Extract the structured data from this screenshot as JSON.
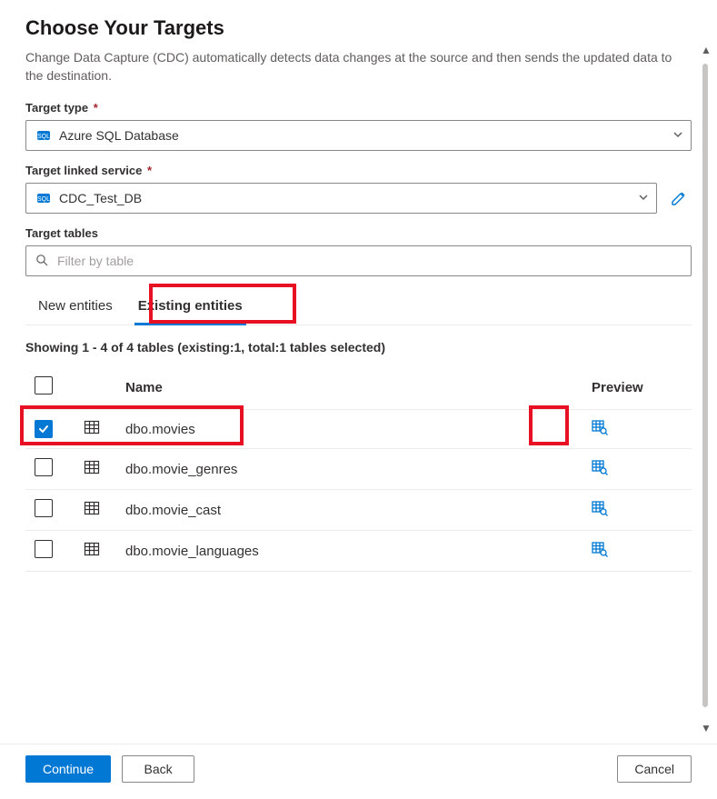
{
  "title": "Choose Your Targets",
  "description": "Change Data Capture (CDC) automatically detects data changes at the source and then sends the updated data to the destination.",
  "target_type": {
    "label": "Target type",
    "required_marker": "*",
    "value": "Azure SQL Database"
  },
  "linked_service": {
    "label": "Target linked service",
    "required_marker": "*",
    "value": "CDC_Test_DB"
  },
  "target_tables": {
    "label": "Target tables",
    "filter_placeholder": "Filter by table"
  },
  "tabs": {
    "new": "New entities",
    "existing": "Existing entities",
    "active": "existing"
  },
  "status_line": "Showing 1 - 4 of 4 tables (existing:1, total:1 tables selected)",
  "table": {
    "headers": {
      "name": "Name",
      "preview": "Preview"
    },
    "rows": [
      {
        "name": "dbo.movies",
        "checked": true
      },
      {
        "name": "dbo.movie_genres",
        "checked": false
      },
      {
        "name": "dbo.movie_cast",
        "checked": false
      },
      {
        "name": "dbo.movie_languages",
        "checked": false
      }
    ]
  },
  "footer": {
    "continue": "Continue",
    "back": "Back",
    "cancel": "Cancel"
  }
}
